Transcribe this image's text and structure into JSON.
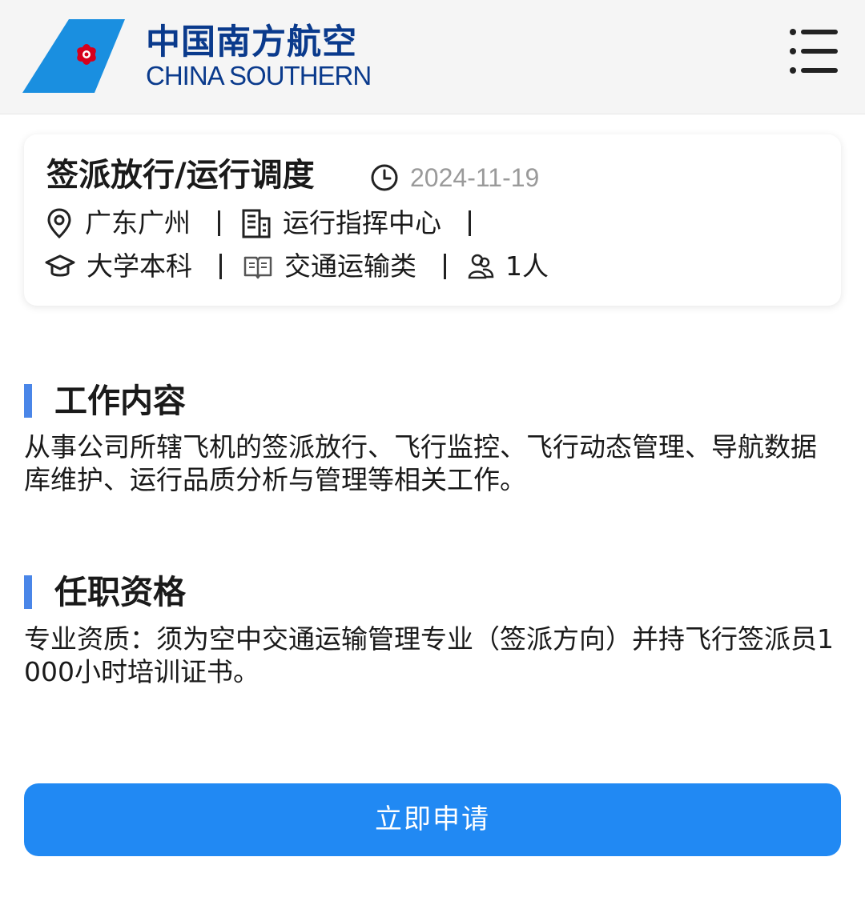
{
  "header": {
    "brand_cn": "中国南方航空",
    "brand_en": "CHINA SOUTHERN",
    "brand_color": "#0a3a8c",
    "logo_color": "#1a8fe0",
    "logo_flower_color": "#d6001c",
    "menu_icon": "menu-icon"
  },
  "job": {
    "title": "签派放行/运行调度",
    "date": "2024-11-19",
    "location": "广东广州",
    "department": "运行指挥中心",
    "education": "大学本科",
    "major": "交通运输类",
    "headcount": "1人"
  },
  "sections": {
    "content": {
      "title": "工作内容",
      "body": "从事公司所辖飞机的签派放行、飞行监控、飞行动态管理、导航数据库维护、运行品质分析与管理等相关工作。"
    },
    "qualification": {
      "title": "任职资格",
      "body": "专业资质：须为空中交通运输管理专业（签派方向）并持飞行签派员1000小时培训证书。"
    }
  },
  "actions": {
    "apply_label": "立即申请",
    "apply_color": "#2189f3"
  },
  "accent_color": "#4a86e8"
}
